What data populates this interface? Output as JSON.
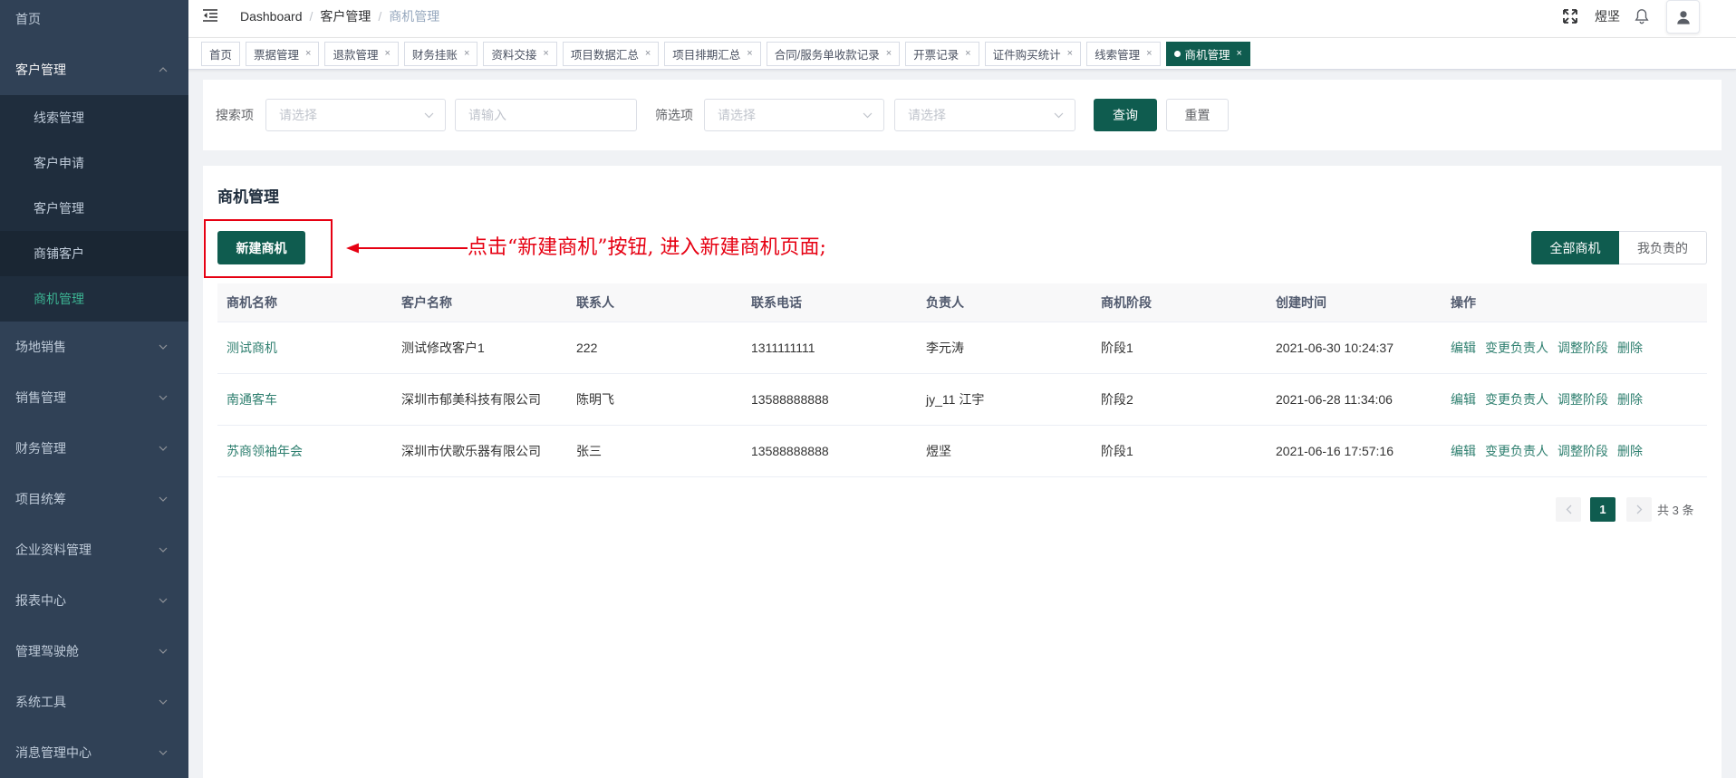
{
  "header": {
    "breadcrumb": {
      "home": "Dashboard",
      "separator": "/",
      "parent": "客户管理",
      "current": "商机管理"
    },
    "user_name": "煜坚",
    "icons": [
      "hamburger-icon",
      "fullscreen-icon",
      "bell-icon",
      "user-icon"
    ]
  },
  "sidebar": {
    "items": [
      {
        "label": "首页"
      },
      {
        "label": "客户管理",
        "expanded": true,
        "children": [
          {
            "label": "线索管理"
          },
          {
            "label": "客户申请"
          },
          {
            "label": "客户管理"
          },
          {
            "label": "商铺客户"
          },
          {
            "label": "商机管理",
            "active": true
          }
        ]
      },
      {
        "label": "场地销售"
      },
      {
        "label": "销售管理"
      },
      {
        "label": "财务管理"
      },
      {
        "label": "项目统筹"
      },
      {
        "label": "企业资料管理"
      },
      {
        "label": "报表中心"
      },
      {
        "label": "管理驾驶舱"
      },
      {
        "label": "系统工具"
      },
      {
        "label": "消息管理中心"
      }
    ]
  },
  "tags": [
    {
      "label": "首页",
      "closable": false
    },
    {
      "label": "票据管理",
      "closable": true
    },
    {
      "label": "退款管理",
      "closable": true
    },
    {
      "label": "财务挂账",
      "closable": true
    },
    {
      "label": "资料交接",
      "closable": true
    },
    {
      "label": "项目数据汇总",
      "closable": true
    },
    {
      "label": "项目排期汇总",
      "closable": true
    },
    {
      "label": "合同/服务单收款记录",
      "closable": true
    },
    {
      "label": "开票记录",
      "closable": true
    },
    {
      "label": "证件购买统计",
      "closable": true
    },
    {
      "label": "线索管理",
      "closable": true
    },
    {
      "label": "商机管理",
      "closable": true,
      "active": true
    }
  ],
  "search": {
    "field_label": "搜索项",
    "field_select_placeholder": "请选择",
    "input_placeholder": "请输入",
    "filter_label": "筛选项",
    "filter_select1_placeholder": "请选择",
    "filter_select2_placeholder": "请选择",
    "query_label": "查询",
    "reset_label": "重置"
  },
  "main": {
    "title": "商机管理",
    "new_button": "新建商机",
    "annotation": "点击“新建商机”按钮, 进入新建商机页面;",
    "filter_tabs": [
      {
        "label": "全部商机",
        "active": true
      },
      {
        "label": "我负责的",
        "active": false
      }
    ],
    "table": {
      "columns": [
        "商机名称",
        "客户名称",
        "联系人",
        "联系电话",
        "负责人",
        "商机阶段",
        "创建时间",
        "操作"
      ],
      "rows": [
        {
          "name": "测试商机",
          "customer": "测试修改客户1",
          "contact": "222",
          "phone": "1311111111",
          "owner": "李元涛",
          "stage": "阶段1",
          "created": "2021-06-30 10:24:37"
        },
        {
          "name": "南通客车",
          "customer": "深圳市郁美科技有限公司",
          "contact": "陈明飞",
          "phone": "13588888888",
          "owner": "jy_11 江宇",
          "stage": "阶段2",
          "created": "2021-06-28 11:34:06"
        },
        {
          "name": "苏商领袖年会",
          "customer": "深圳市伏歌乐器有限公司",
          "contact": "张三",
          "phone": "13588888888",
          "owner": "煜坚",
          "stage": "阶段1",
          "created": "2021-06-16 17:57:16"
        }
      ],
      "actions": [
        "编辑",
        "变更负责人",
        "调整阶段",
        "删除"
      ]
    },
    "pagination": {
      "current": "1",
      "total_text": "共 3 条"
    }
  },
  "colors": {
    "primary": "#0f5c4f",
    "link": "#2e7f6f",
    "sidebar_bg": "#304156",
    "submenu_bg": "#1f2d3d",
    "sidebar_active": "#3cb493",
    "annotation": "#e60012"
  }
}
